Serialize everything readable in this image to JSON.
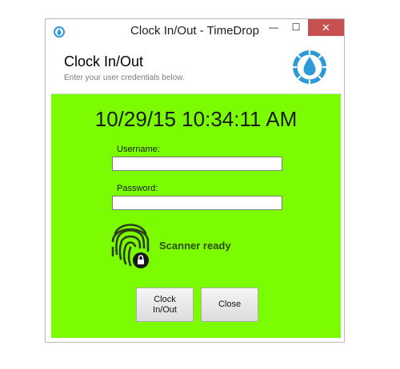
{
  "window": {
    "title": "Clock In/Out - TimeDrop",
    "controls": {
      "minimize": "—",
      "maximize": "☐",
      "close": "✕"
    }
  },
  "header": {
    "title": "Clock In/Out",
    "subtitle": "Enter your user credentials below.",
    "logo_icon": "timedrop-drop-logo"
  },
  "main": {
    "datetime": "10/29/15 10:34:11 AM",
    "username": {
      "label": "Username:",
      "value": ""
    },
    "password": {
      "label": "Password:",
      "value": ""
    },
    "scanner_status": "Scanner ready",
    "fingerprint_icon": "fingerprint-lock-icon",
    "buttons": {
      "clock": "Clock\nIn/Out",
      "close": "Close"
    }
  },
  "colors": {
    "background_green": "#7cfc00",
    "accent_blue": "#2d9ad8",
    "close_red": "#c75050"
  }
}
